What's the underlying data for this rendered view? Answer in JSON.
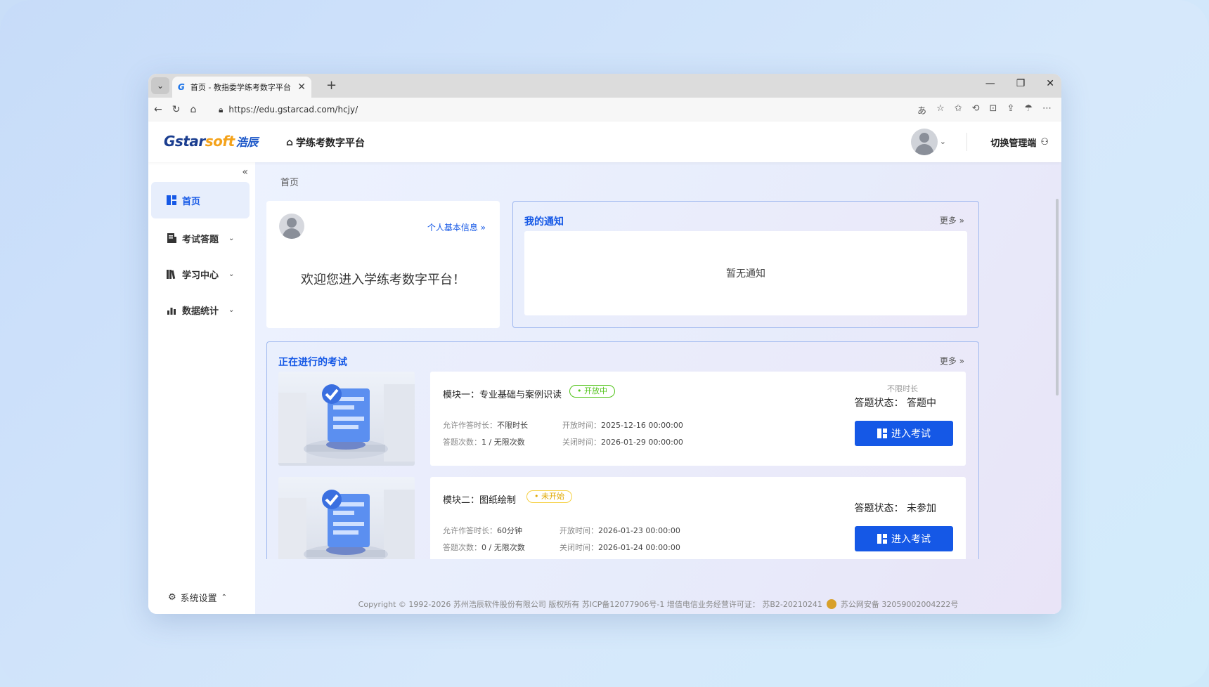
{
  "browser": {
    "tab_title": "首页 - 教指委学练考数字平台",
    "tab_favicon": "G",
    "url": "https://edu.gstarcad.com/hcjy/"
  },
  "header": {
    "logo_main": "Gstar",
    "logo_soft": "soft",
    "logo_cn": "浩辰",
    "platform_name": "学练考数字平台",
    "switch_label": "切换管理端"
  },
  "sidebar": {
    "items": [
      {
        "label": "首页",
        "icon": "dashboard-icon"
      },
      {
        "label": "考试答题",
        "icon": "exam-icon"
      },
      {
        "label": "学习中心",
        "icon": "books-icon"
      },
      {
        "label": "数据统计",
        "icon": "chart-icon"
      }
    ],
    "settings_label": "系统设置"
  },
  "breadcrumb": "首页",
  "welcome": {
    "link": "个人基本信息",
    "message": "欢迎您进入学练考数字平台！"
  },
  "notice": {
    "title": "我的通知",
    "more": "更多",
    "empty": "暂无通知"
  },
  "exams": {
    "title": "正在进行的考试",
    "more": "更多",
    "items": [
      {
        "name": "模块一：专业基础与案例识读",
        "badge": "• 开放中",
        "duration_label": "允许作答时长：",
        "duration": "不限时长",
        "attempts_label": "答题次数：",
        "attempts": "1 / 无限次数",
        "open_label": "开放时间：",
        "open_time": "2025-12-16 00:00:00",
        "close_label": "关闭时间：",
        "close_time": "2026-01-29 00:00:00",
        "nolimit": "不限时长",
        "status": "答题状态：  答题中",
        "button": "进入考试"
      },
      {
        "name": "模块二：图纸绘制",
        "badge": "• 未开始",
        "duration_label": "允许作答时长：",
        "duration": "60分钟",
        "attempts_label": "答题次数：",
        "attempts": "0 / 无限次数",
        "open_label": "开放时间：",
        "open_time": "2026-01-23 00:00:00",
        "close_label": "关闭时间：",
        "close_time": "2026-01-24 00:00:00",
        "status": "答题状态：  未参加",
        "button": "进入考试"
      }
    ]
  },
  "footer": {
    "copyright": "Copyright © 1992-2026 苏州浩辰软件股份有限公司 版权所有 苏ICP备12077906号-1 增值电信业务经营许可证： 苏B2-20210241",
    "police": "苏公网安备 32059002004222号"
  },
  "colors": {
    "accent": "#1558e6",
    "open": "#52c41a",
    "wait": "#e0a800"
  }
}
